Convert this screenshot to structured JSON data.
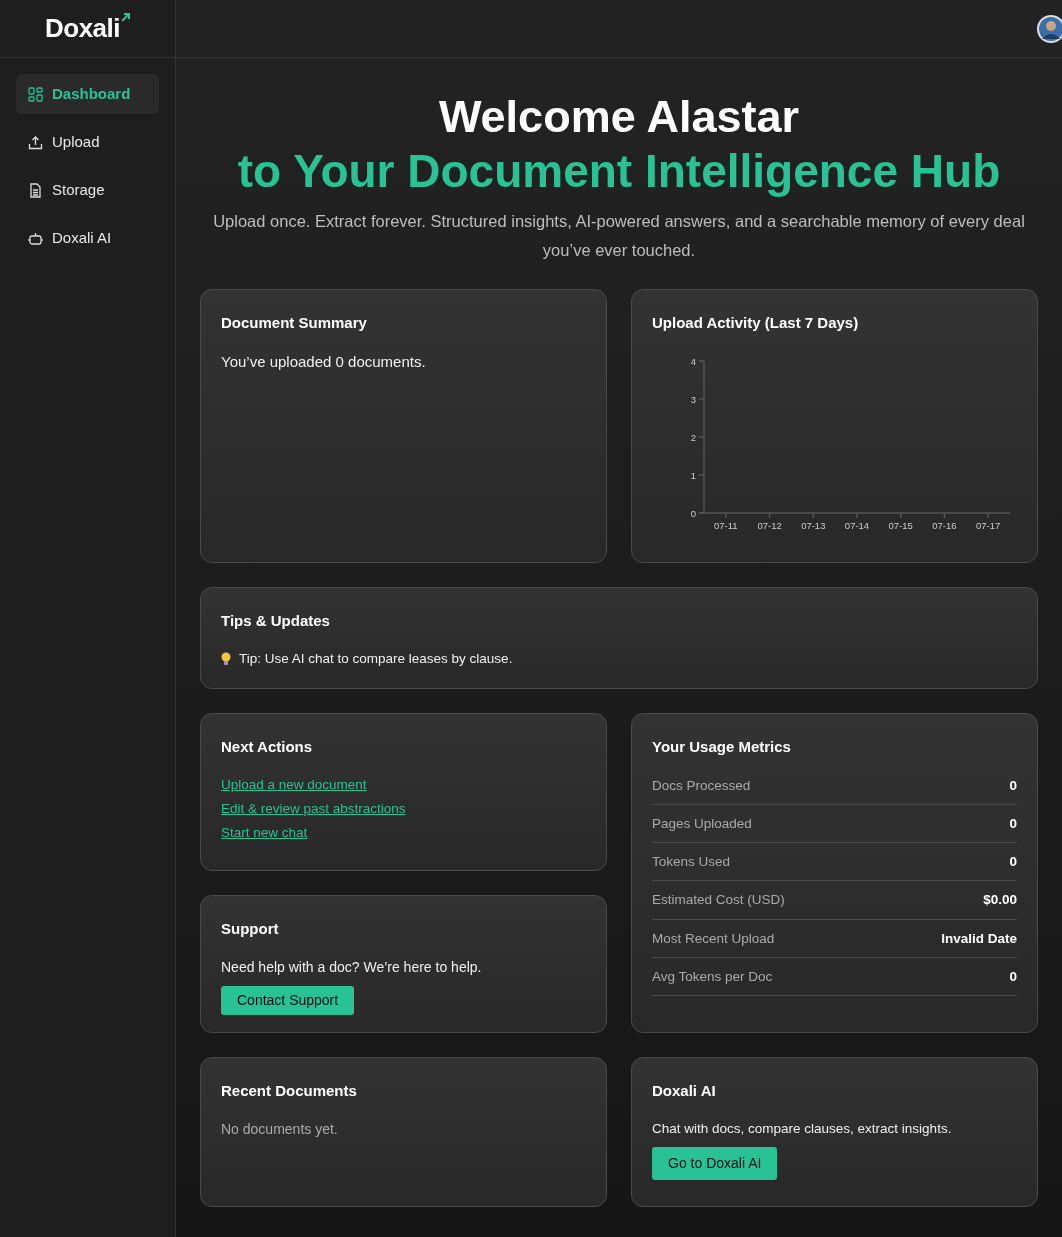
{
  "brand": {
    "name": "Doxali"
  },
  "sidebar": {
    "items": [
      {
        "label": "Dashboard",
        "selected": true
      },
      {
        "label": "Upload",
        "selected": false
      },
      {
        "label": "Storage",
        "selected": false
      },
      {
        "label": "Doxali AI",
        "selected": false
      }
    ]
  },
  "hero": {
    "title": "Welcome Alastar",
    "subtitle": "to Your Document Intelligence Hub",
    "tagline": "Upload once. Extract forever. Structured insights, AI-powered answers, and a searchable memory of every deal you’ve ever touched."
  },
  "summary": {
    "title": "Document Summary",
    "text": "You’ve uploaded 0 documents."
  },
  "activity": {
    "title": "Upload Activity (Last 7 Days)",
    "chart_data": {
      "type": "bar",
      "categories": [
        "07-11",
        "07-12",
        "07-13",
        "07-14",
        "07-15",
        "07-16",
        "07-17"
      ],
      "values": [
        0,
        0,
        0,
        0,
        0,
        0,
        0
      ],
      "ylim": [
        0,
        4
      ],
      "yticks": [
        0,
        1,
        2,
        3,
        4
      ]
    }
  },
  "tips": {
    "title": "Tips & Updates",
    "text": "Tip: Use AI chat to compare leases by clause."
  },
  "next_actions": {
    "title": "Next Actions",
    "links": [
      "Upload a new document",
      "Edit & review past abstractions",
      "Start new chat"
    ]
  },
  "support": {
    "title": "Support",
    "text": "Need help with a doc? We’re here to help.",
    "button": "Contact Support"
  },
  "metrics": {
    "title": "Your Usage Metrics",
    "rows": [
      {
        "label": "Docs Processed",
        "value": "0"
      },
      {
        "label": "Pages Uploaded",
        "value": "0"
      },
      {
        "label": "Tokens Used",
        "value": "0"
      },
      {
        "label": "Estimated Cost (USD)",
        "value": "$0.00"
      },
      {
        "label": "Most Recent Upload",
        "value": "Invalid Date"
      },
      {
        "label": "Avg Tokens per Doc",
        "value": "0"
      }
    ]
  },
  "recent": {
    "title": "Recent Documents",
    "text": "No documents yet."
  },
  "ai": {
    "title": "Doxali AI",
    "text": "Chat with docs, compare clauses, extract insights.",
    "button": "Go to Doxali AI"
  }
}
